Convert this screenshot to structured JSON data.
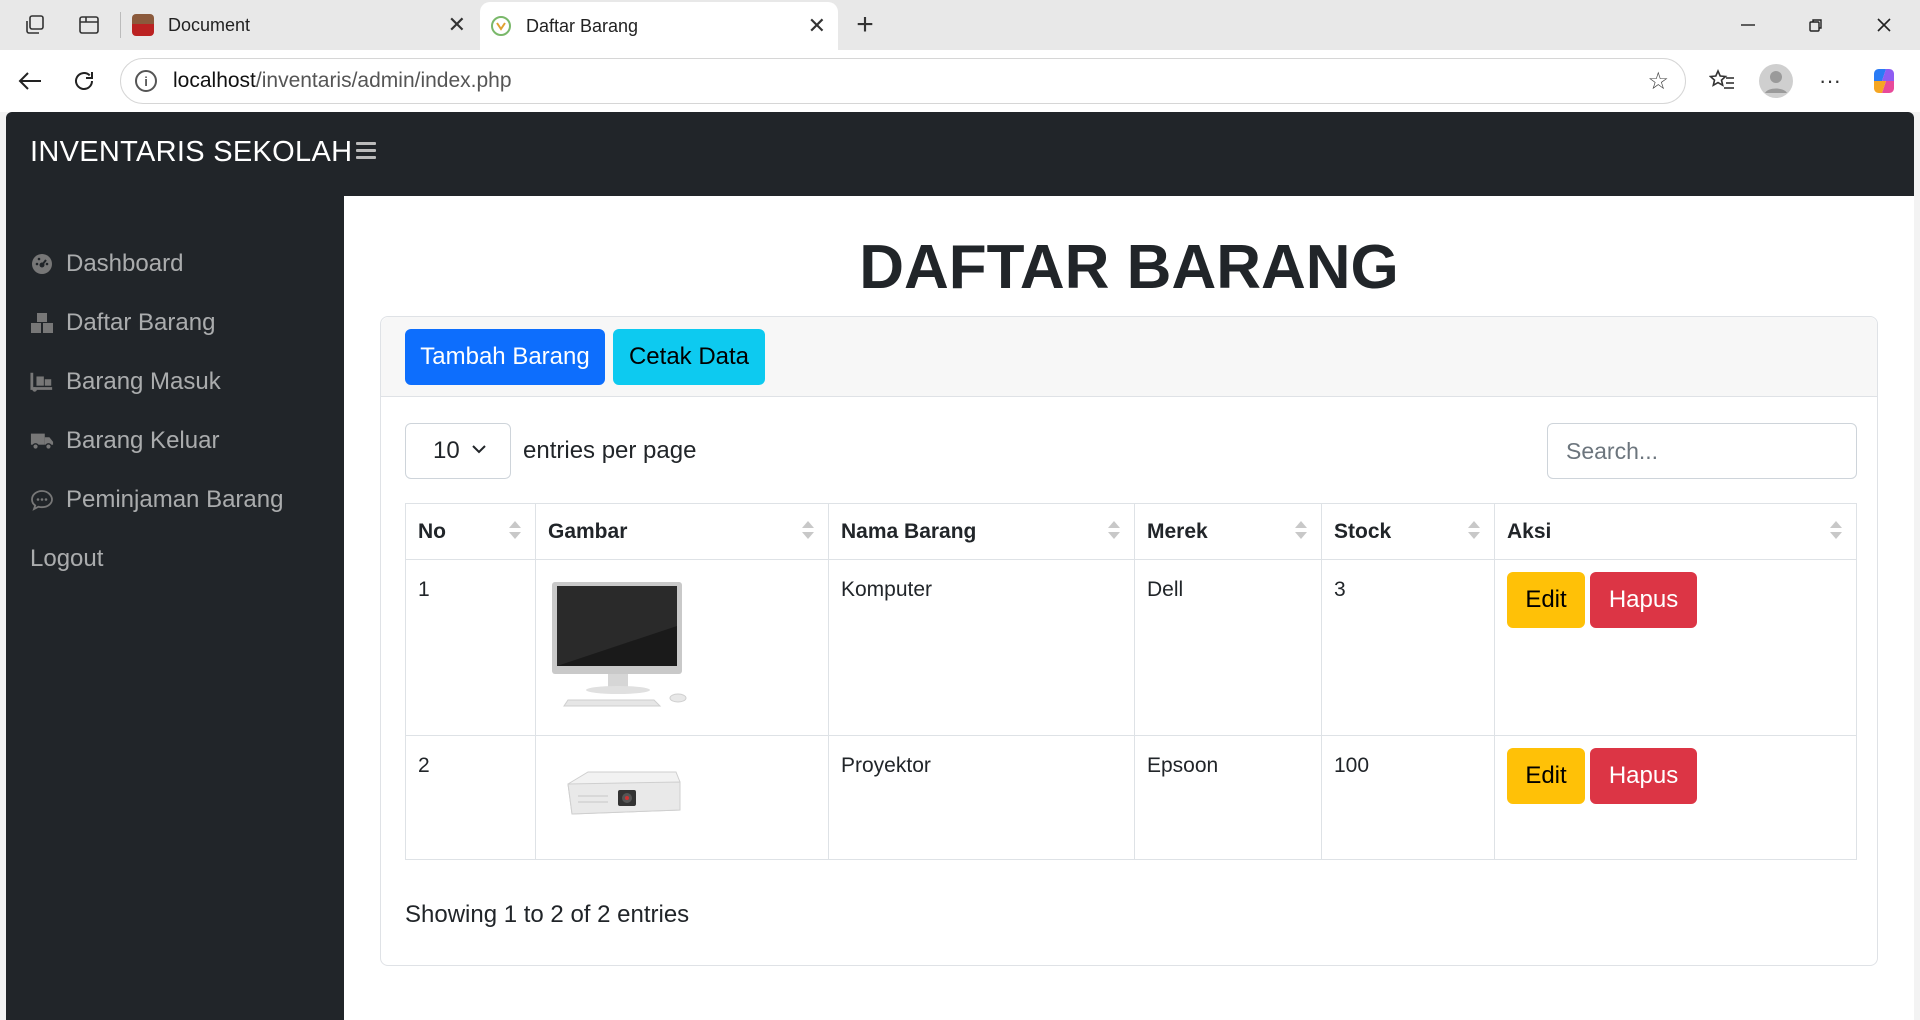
{
  "browser": {
    "tabs": [
      {
        "title": "Document",
        "active": false
      },
      {
        "title": "Daftar Barang",
        "active": true
      }
    ],
    "url_host": "localhost",
    "url_path": "/inventaris/admin/index.php"
  },
  "navbar": {
    "brand": "INVENTARIS SEKOLAH"
  },
  "sidebar": {
    "items": [
      {
        "label": "Dashboard",
        "icon": "dashboard-icon"
      },
      {
        "label": "Daftar Barang",
        "icon": "boxes-icon"
      },
      {
        "label": "Barang Masuk",
        "icon": "dolly-icon"
      },
      {
        "label": "Barang Keluar",
        "icon": "truck-icon"
      },
      {
        "label": "Peminjaman Barang",
        "icon": "chat-icon"
      },
      {
        "label": "Logout",
        "icon": ""
      }
    ]
  },
  "main": {
    "title": "DAFTAR BARANG",
    "buttons": {
      "add": "Tambah Barang",
      "print": "Cetak Data"
    },
    "entries": {
      "value": "10",
      "label": "entries per page"
    },
    "search_placeholder": "Search...",
    "table": {
      "headers": [
        "No",
        "Gambar",
        "Nama Barang",
        "Merek",
        "Stock",
        "Aksi"
      ],
      "rows": [
        {
          "no": "1",
          "image": "computer-monitor-image",
          "nama": "Komputer",
          "merek": "Dell",
          "stock": "3",
          "edit": "Edit",
          "hapus": "Hapus"
        },
        {
          "no": "2",
          "image": "projector-image",
          "nama": "Proyektor",
          "merek": "Epsoon",
          "stock": "100",
          "edit": "Edit",
          "hapus": "Hapus"
        }
      ]
    },
    "showing": "Showing 1 to 2 of 2 entries"
  },
  "colors": {
    "sidebar_bg": "#212529",
    "primary": "#0d6efd",
    "info": "#0dcaf0",
    "warning": "#ffc107",
    "danger": "#dc3545"
  }
}
